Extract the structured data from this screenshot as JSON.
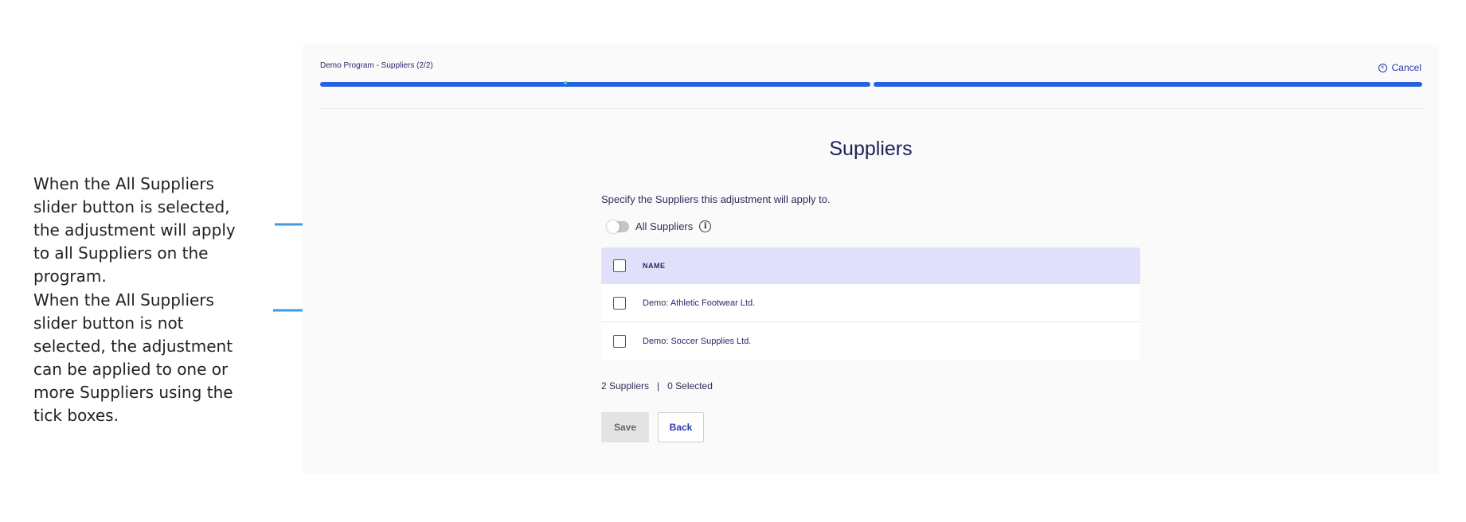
{
  "annotations": {
    "note_1": "When the All Suppliers slider button is selected, the adjustment will apply to all Suppliers on the program.",
    "note_2": "When the All Suppliers slider button is not selected, the adjustment can be applied to one or more Suppliers using the tick boxes.",
    "arrow_color": "#3b9be6"
  },
  "header": {
    "step_title": "Demo Program - Suppliers (2/2)",
    "cancel_label": "Cancel",
    "progress_steps_total": 2,
    "progress_steps_complete": 2,
    "progress_color": "#2762e0"
  },
  "main": {
    "title": "Suppliers",
    "instruction": "Specify the Suppliers this adjustment will apply to.",
    "all_suppliers_toggle": {
      "label": "All Suppliers",
      "on": false
    },
    "table": {
      "column_name": "NAME",
      "rows": [
        {
          "name": "Demo: Athletic Footwear Ltd.",
          "checked": false
        },
        {
          "name": "Demo: Soccer Supplies Ltd.",
          "checked": false
        }
      ]
    },
    "summary": {
      "count": "2 Suppliers",
      "separator": "|",
      "selected": "0 Selected"
    },
    "buttons": {
      "save": "Save",
      "back": "Back"
    }
  }
}
